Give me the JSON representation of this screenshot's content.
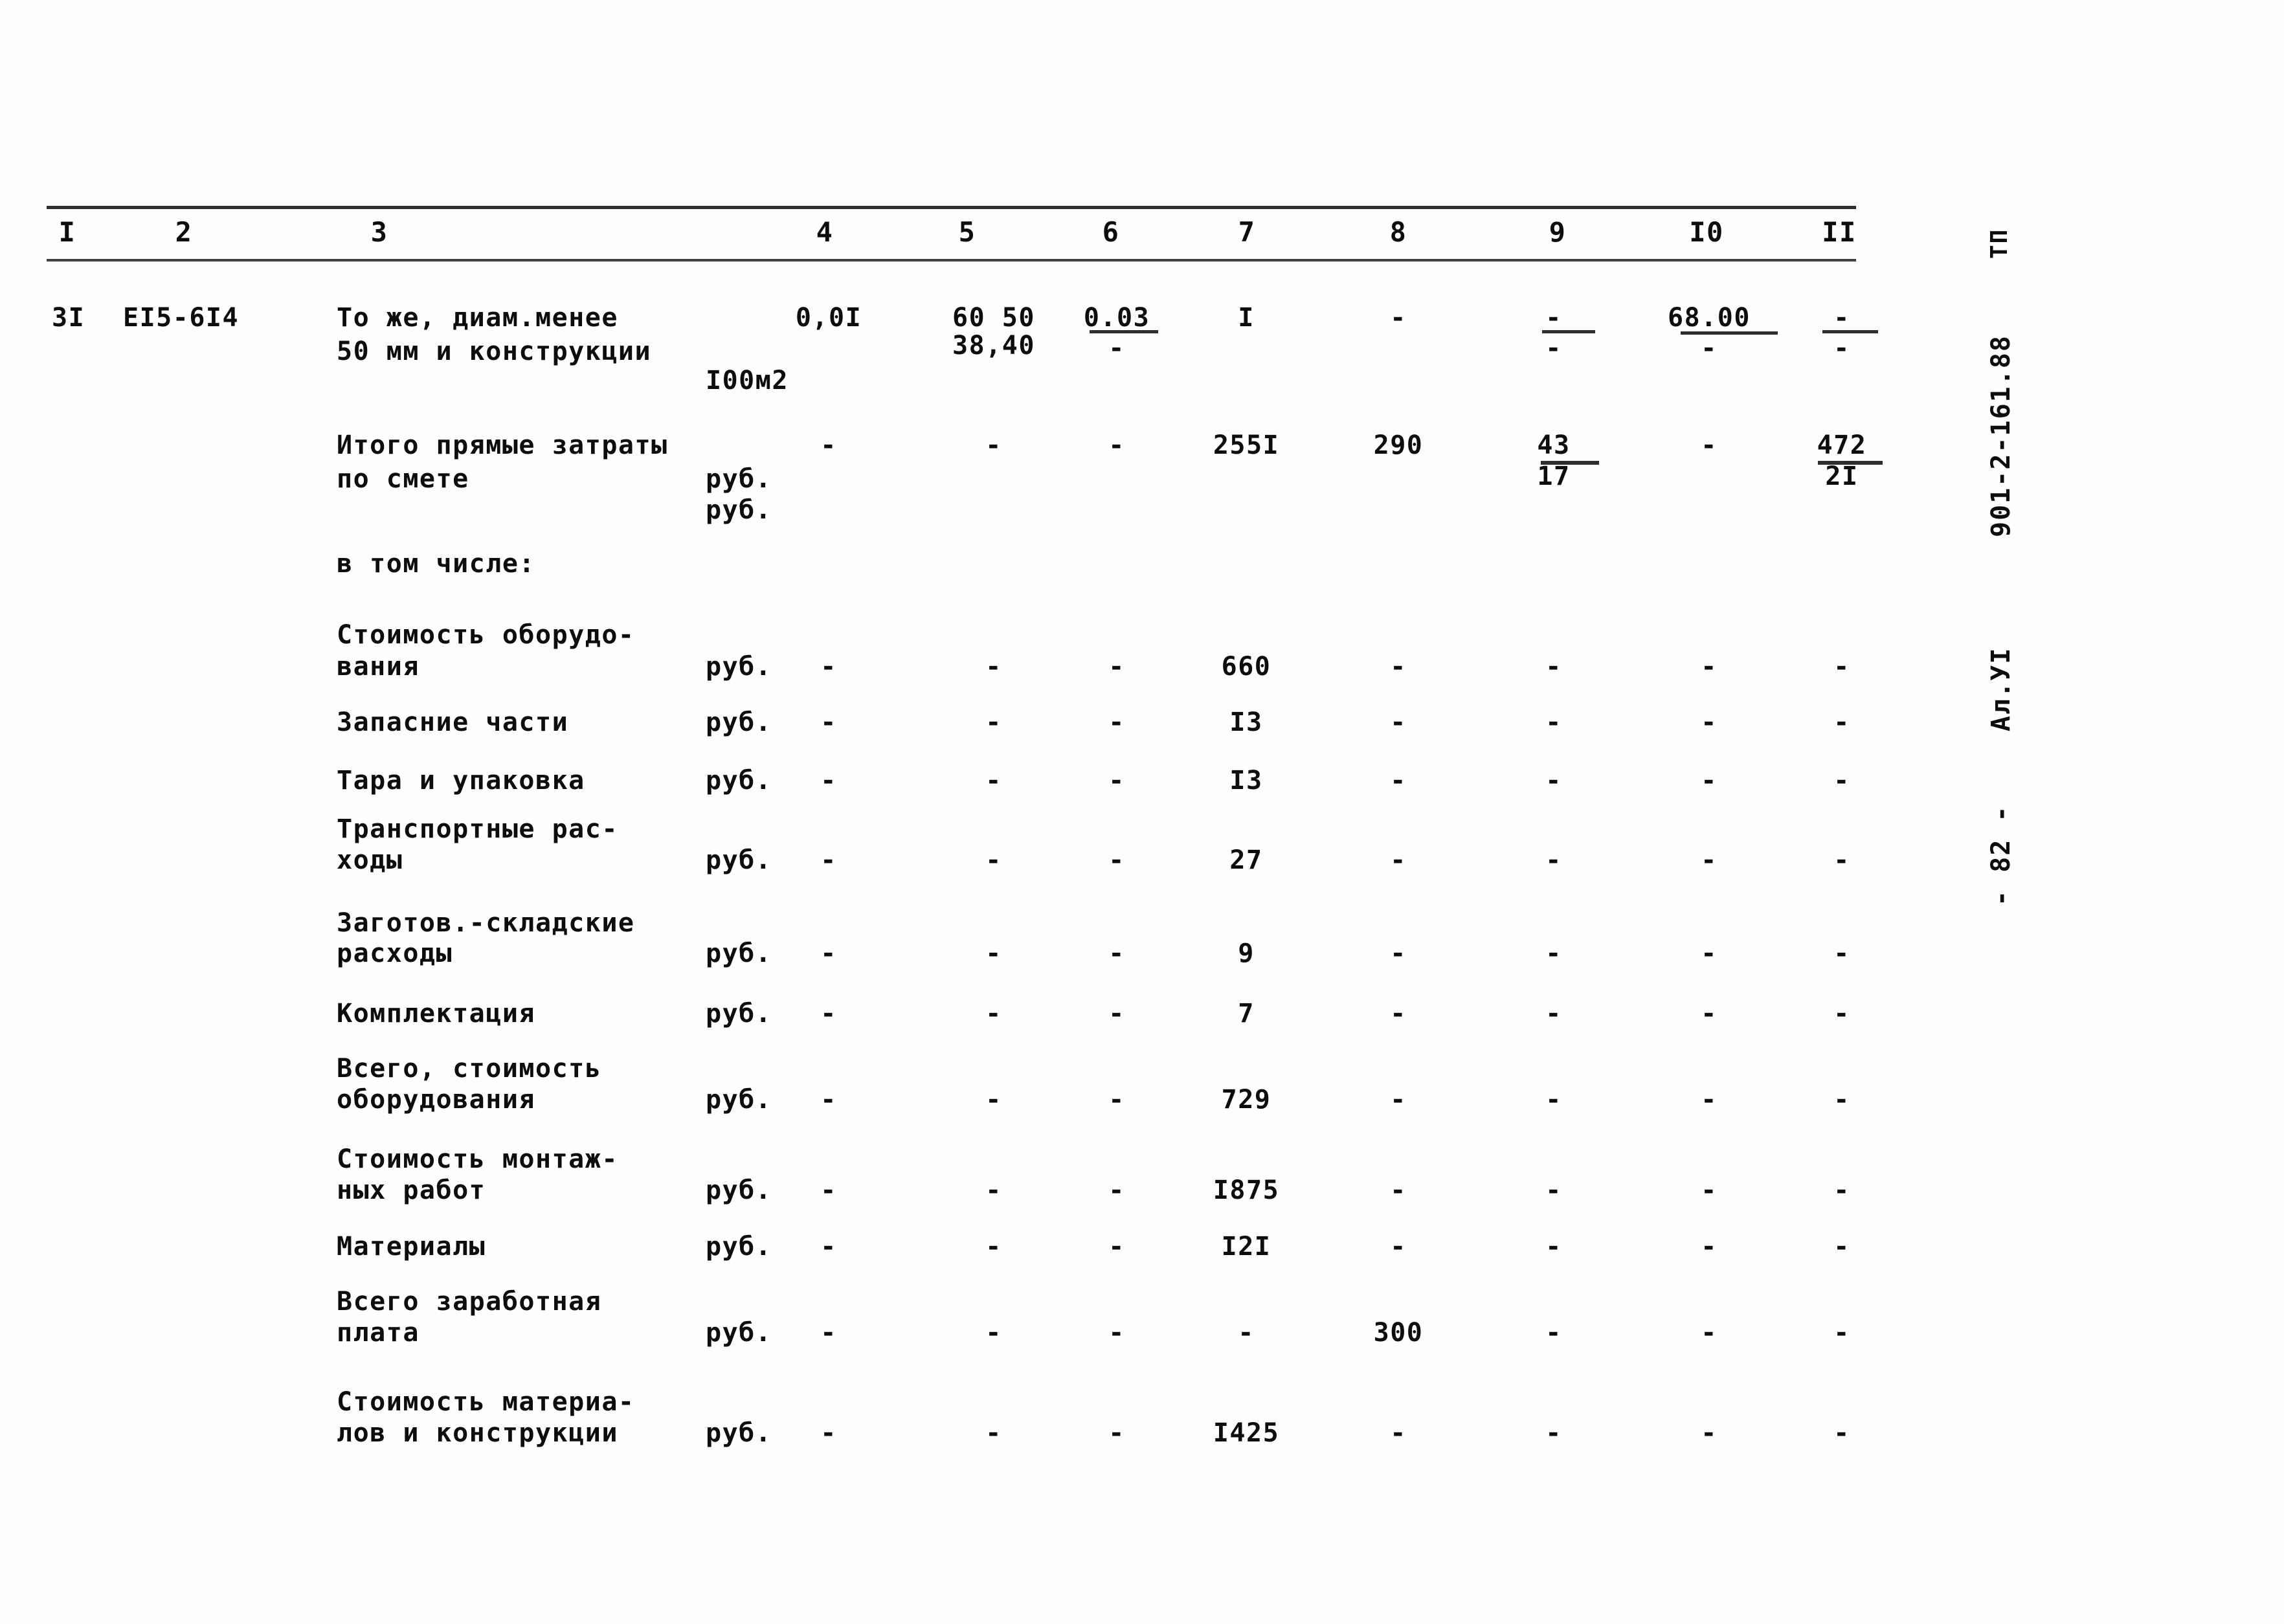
{
  "page": {
    "sheet_number": "- 82 -",
    "album": "Ал.УI",
    "project_code": "901-2-161.88",
    "project_prefix": "ТП"
  },
  "table": {
    "column_headers": [
      "I",
      "2",
      "3",
      "4",
      "5",
      "6",
      "7",
      "8",
      "9",
      "I0",
      "II"
    ],
    "rows": [
      {
        "kind": "item",
        "num": "3I",
        "code": "EI5-6I4",
        "name_line1": "То же, диам.менее",
        "name_line2": "50 мм и конструкции",
        "unit": "I00м2",
        "c4": "0,0I",
        "c5_top": "60 50",
        "c5_bot": "38,40",
        "c6_top": "0.03",
        "c6_bot": "-",
        "c7": "I",
        "c8": "-",
        "c9_top": "-",
        "c9_bot": "-",
        "c10_top": "68.00",
        "c10_bot": "-",
        "c11_top": "-",
        "c11_bot": "-"
      },
      {
        "kind": "total",
        "name_line1": "Итого прямые затраты",
        "name_line2": "по смете",
        "unit_line1": "руб.",
        "unit_line2": "руб.",
        "c4": "-",
        "c5": "-",
        "c6": "-",
        "c7": "255I",
        "c8": "290",
        "c9_top": "43",
        "c9_bot": "17",
        "c10": "-",
        "c11_top": "472",
        "c11_bot": "2I"
      },
      {
        "kind": "caption",
        "name_line1": "в том числе:"
      },
      {
        "kind": "sub",
        "name_line1": "Стоимость оборудо-",
        "name_line2": "вания",
        "unit": "руб.",
        "c4": "-",
        "c5": "-",
        "c6": "-",
        "c7": "660",
        "c8": "-",
        "c9": "-",
        "c10": "-",
        "c11": "-"
      },
      {
        "kind": "sub",
        "name_line1": "Запасние части",
        "name_line2": "",
        "unit": "руб.",
        "c4": "-",
        "c5": "-",
        "c6": "-",
        "c7": "I3",
        "c8": "-",
        "c9": "-",
        "c10": "-",
        "c11": "-"
      },
      {
        "kind": "sub",
        "name_line1": "Тара и упаковка",
        "name_line2": "",
        "unit": "руб.",
        "c4": "-",
        "c5": "-",
        "c6": "-",
        "c7": "I3",
        "c8": "-",
        "c9": "-",
        "c10": "-",
        "c11": "-"
      },
      {
        "kind": "sub",
        "name_line1": "Транспортные рас-",
        "name_line2": "ходы",
        "unit": "руб.",
        "c4": "-",
        "c5": "-",
        "c6": "-",
        "c7": "27",
        "c8": "-",
        "c9": "-",
        "c10": "-",
        "c11": "-"
      },
      {
        "kind": "sub",
        "name_line1": "Заготов.-складские",
        "name_line2": "расходы",
        "unit": "руб.",
        "c4": "-",
        "c5": "-",
        "c6": "-",
        "c7": "9",
        "c8": "-",
        "c9": "-",
        "c10": "-",
        "c11": "-"
      },
      {
        "kind": "sub",
        "name_line1": "Комплектация",
        "name_line2": "",
        "unit": "руб.",
        "c4": "-",
        "c5": "-",
        "c6": "-",
        "c7": "7",
        "c8": "-",
        "c9": "-",
        "c10": "-",
        "c11": "-"
      },
      {
        "kind": "sub",
        "name_line1": "Всего, стоимость",
        "name_line2": "оборудования",
        "unit": "руб.",
        "c4": "-",
        "c5": "-",
        "c6": "-",
        "c7": "729",
        "c8": "-",
        "c9": "-",
        "c10": "-",
        "c11": "-"
      },
      {
        "kind": "sub",
        "name_line1": "Стоимость монтаж-",
        "name_line2": "ных работ",
        "unit": "руб.",
        "c4": "-",
        "c5": "-",
        "c6": "-",
        "c7": "I875",
        "c8": "-",
        "c9": "-",
        "c10": "-",
        "c11": "-"
      },
      {
        "kind": "sub",
        "name_line1": "Материалы",
        "name_line2": "",
        "unit": "руб.",
        "c4": "-",
        "c5": "-",
        "c6": "-",
        "c7": "I2I",
        "c8": "-",
        "c9": "-",
        "c10": "-",
        "c11": "-"
      },
      {
        "kind": "sub",
        "name_line1": "Всего заработная",
        "name_line2": "плата",
        "unit": "руб.",
        "c4": "-",
        "c5": "-",
        "c6": "-",
        "c7": "-",
        "c8": "300",
        "c9": "-",
        "c10": "-",
        "c11": "-"
      },
      {
        "kind": "sub",
        "name_line1": "Стоимость материа-",
        "name_line2": "лов и конструкции",
        "unit": "руб.",
        "c4": "-",
        "c5": "-",
        "c6": "-",
        "c7": "I425",
        "c8": "-",
        "c9": "-",
        "c10": "-",
        "c11": "-"
      }
    ]
  }
}
